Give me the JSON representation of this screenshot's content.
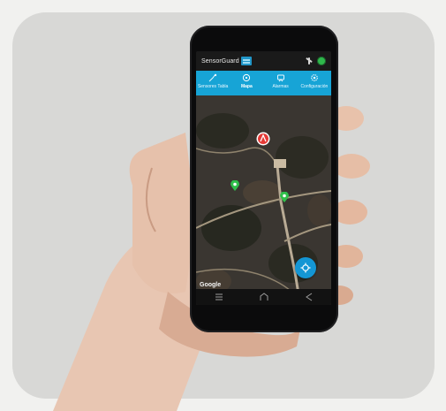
{
  "app": {
    "brand_name": "SensorGuard",
    "connection_status": "connected"
  },
  "tabs": [
    {
      "label": "Sensores Tabla",
      "icon": "sensor-list-icon"
    },
    {
      "label": "Mapa",
      "icon": "map-icon",
      "active": true
    },
    {
      "label": "Alarmas",
      "icon": "alarm-icon"
    },
    {
      "label": "Configuración",
      "icon": "settings-icon"
    }
  ],
  "map": {
    "attribution": "Google",
    "markers": [
      {
        "type": "alert",
        "color": "#e53935"
      },
      {
        "type": "sensor",
        "color": "#2fbf4a"
      },
      {
        "type": "sensor",
        "color": "#2fbf4a"
      }
    ],
    "locate_button": "my-location-icon"
  },
  "colors": {
    "accent": "#17a4d6",
    "sensor_marker": "#2fbf4a",
    "alert_marker": "#e53935"
  }
}
